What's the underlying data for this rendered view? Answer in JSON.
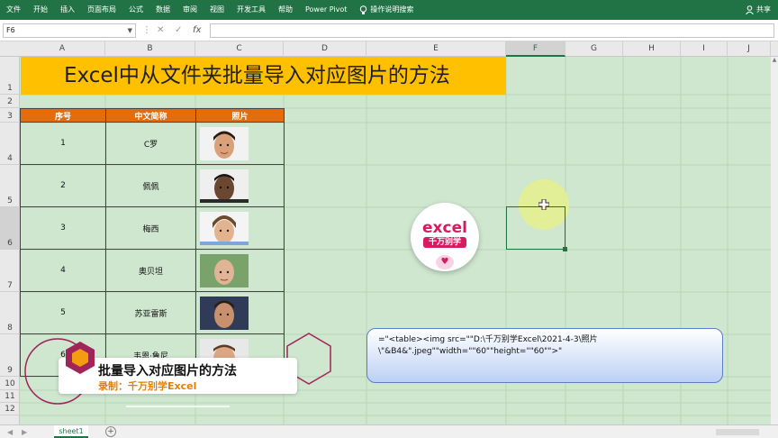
{
  "ribbon": {
    "tabs": [
      "文件",
      "开始",
      "插入",
      "页面布局",
      "公式",
      "数据",
      "审阅",
      "视图",
      "开发工具",
      "帮助",
      "Power Pivot"
    ],
    "tell_me": "操作说明搜索",
    "share": "共享",
    "bg_color": "#217346"
  },
  "formula_bar": {
    "name_box": "F6",
    "formula": ""
  },
  "columns": [
    "A",
    "B",
    "C",
    "D",
    "E",
    "F",
    "G",
    "H",
    "I",
    "J"
  ],
  "selected_column": "F",
  "rows": [
    "1",
    "2",
    "3",
    "4",
    "5",
    "6",
    "7",
    "8",
    "9",
    "10",
    "11",
    "12"
  ],
  "title": "Excel中从文件夹批量导入对应图片的方法",
  "table": {
    "headers": [
      "序号",
      "中文简称",
      "照片"
    ],
    "rows": [
      {
        "no": "1",
        "name": "C罗"
      },
      {
        "no": "2",
        "name": "佩佩"
      },
      {
        "no": "3",
        "name": "梅西"
      },
      {
        "no": "4",
        "name": "奥贝坦"
      },
      {
        "no": "5",
        "name": "苏亚雷斯"
      },
      {
        "no": "6",
        "name": "韦恩·鲁尼"
      }
    ],
    "header_color": "#e46c0a"
  },
  "logo": {
    "line1": "excel",
    "line2": "千万别学",
    "color": "#d81b60"
  },
  "callout": {
    "line1": "=\"<table><img src=\"\"D:\\千万别学Excel\\2021-4-3\\照片",
    "line2": "\\\"&B4&\".jpeg\"\"width=\"\"60\"\"height=\"\"60\"\">\""
  },
  "caption": {
    "title": "批量导入对应图片的方法",
    "subtitle": "录制：千万别学Excel",
    "accent": "#e67e00"
  },
  "sheet_tabs": [
    "sheet1"
  ],
  "title_bg": "#ffc000",
  "grid_bg": "#cfe6cf"
}
